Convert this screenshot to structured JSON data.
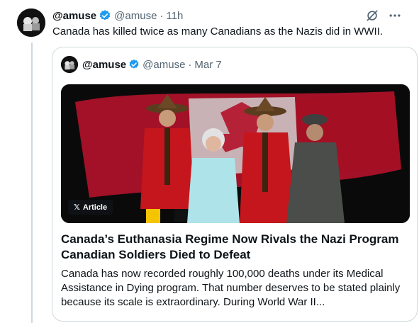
{
  "tweet": {
    "display_name": "@amuse",
    "handle": "@amuse",
    "separator": "·",
    "timestamp": "11h",
    "text": "Canada has killed twice as many Canadians as the Nazis did in WWII.",
    "icons": {
      "grok": "grok-icon",
      "more": "more-icon",
      "verified": "verified-badge-icon"
    }
  },
  "quoted_tweet": {
    "display_name": "@amuse",
    "handle": "@amuse",
    "separator": "·",
    "timestamp": "Mar 7",
    "badge_label": "Article",
    "article": {
      "title_lines": [
        "Canada’s Euthanasia Regime Now Rivals the Nazi Program",
        "Canadian Soldiers Died to Defeat"
      ],
      "excerpt_lines": [
        "Canada has now recorded roughly 100,000 deaths under its Medical",
        "Assistance in Dying program. That number deserves to be stated plainly",
        "because its scale is extraordinary. During World War II..."
      ]
    }
  },
  "colors": {
    "verified": "#1d9bf0",
    "text": "#0f1419",
    "muted": "#536471",
    "border": "#cfd9de",
    "flag_red": "#c8102e"
  }
}
